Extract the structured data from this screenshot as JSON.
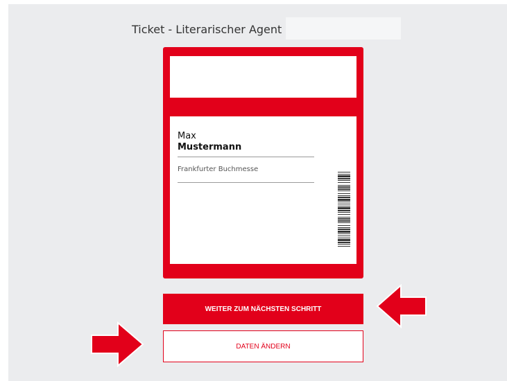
{
  "page": {
    "title": "Ticket - Literarischer Agent"
  },
  "ticket": {
    "first_name": "Max",
    "last_name": "Mustermann",
    "event": "Frankfurter Buchmesse"
  },
  "buttons": {
    "next": "WEITER ZUM NÄCHSTEN SCHRITT",
    "edit": "DATEN ÄNDERN"
  },
  "colors": {
    "accent": "#e2001a",
    "panel": "#ebecee"
  },
  "icons": {
    "annotation_left": "red-arrow-right-icon",
    "annotation_right": "red-arrow-left-icon",
    "barcode": "barcode-icon"
  }
}
